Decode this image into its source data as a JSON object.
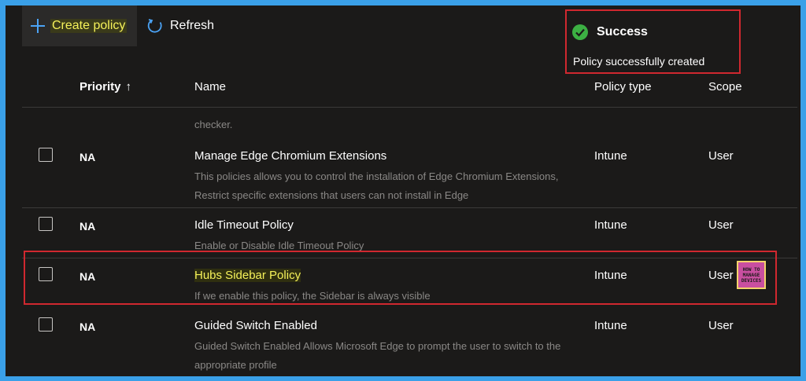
{
  "toolbar": {
    "create_label": "Create policy",
    "refresh_label": "Refresh"
  },
  "toast": {
    "title": "Success",
    "message": "Policy successfully created"
  },
  "table": {
    "columns": {
      "priority": "Priority",
      "name": "Name",
      "policy_type": "Policy type",
      "scope": "Scope"
    },
    "truncated_desc": "checker.",
    "rows": [
      {
        "priority": "NA",
        "name": "Manage Edge Chromium Extensions",
        "description": "This policies allows you to control the installation of Edge Chromium Extensions, Restrict specific extensions that users can not install in Edge",
        "policy_type": "Intune",
        "scope": "User"
      },
      {
        "priority": "NA",
        "name": "Idle Timeout Policy",
        "description": "Enable or Disable Idle Timeout Policy",
        "policy_type": "Intune",
        "scope": "User"
      },
      {
        "priority": "NA",
        "name": "Hubs Sidebar Policy",
        "description": "If we enable this policy, the Sidebar is always visible",
        "policy_type": "Intune",
        "scope": "User"
      },
      {
        "priority": "NA",
        "name": "Guided Switch Enabled",
        "description": "Guided Switch Enabled Allows Microsoft Edge to prompt the user to switch to the appropriate profile",
        "policy_type": "Intune",
        "scope": "User"
      }
    ]
  },
  "logo": {
    "lines": [
      "HOW TO",
      "MANAGE",
      "DEVICES"
    ]
  },
  "colors": {
    "accent": "#4ba3f5",
    "success": "#3cb043",
    "highlight_border": "#d0282f",
    "highlight_text": "#f5f15a"
  }
}
